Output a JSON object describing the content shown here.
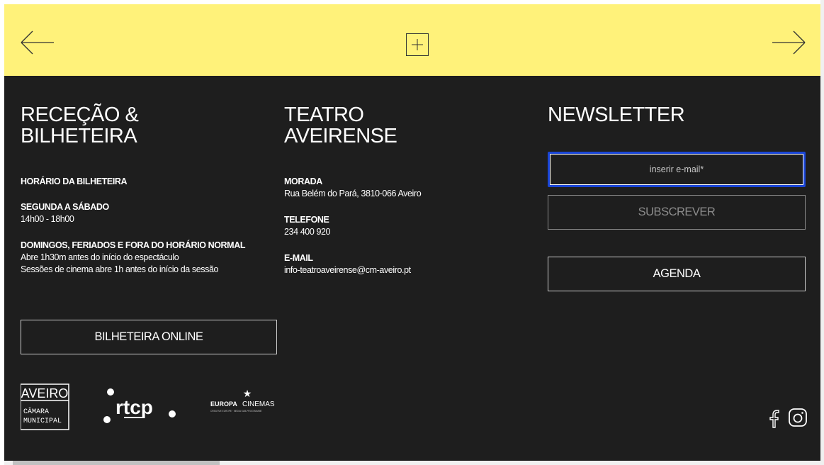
{
  "nav": {
    "prev_icon": "arrow-left-icon",
    "next_icon": "arrow-right-icon",
    "expand_icon": "plus-icon",
    "bar_color": "#fff27a"
  },
  "reception": {
    "title": "RECEÇÃO & BILHETEIRA",
    "hours_title": "HORÁRIO DA BILHETEIRA",
    "weekday_label": "SEGUNDA A SÁBADO",
    "weekday_hours": "14h00 - 18h00",
    "weekend_label": "DOMINGOS, FERIADOS E FORA DO HORÁRIO NORMAL",
    "weekend_line1": "Abre 1h30m antes do início do espectáculo",
    "weekend_line2": "Sessões de cinema abre 1h antes do início da sessão",
    "online_button": "BILHETEIRA ONLINE"
  },
  "theatre": {
    "title": "TEATRO AVEIRENSE",
    "address_label": "MORADA",
    "address_value": "Rua Belém do Pará, 3810-066 Aveiro",
    "phone_label": "TELEFONE",
    "phone_value": "234 400 920",
    "email_label": "E-MAIL",
    "email_value": "info-teatroaveirense@cm-aveiro.pt"
  },
  "newsletter": {
    "title": "NEWSLETTER",
    "email_placeholder": "inserir e-mail*",
    "subscribe_button": "SUBSCREVER",
    "agenda_button": "AGENDA"
  },
  "logos": {
    "aveiro_top": "AVEIRO",
    "aveiro_bottom1": "CÂMARA",
    "aveiro_bottom2": "MUNICIPAL",
    "rtcp": "rtcp",
    "europa_main": "EUROPA",
    "europa_cinemas": "CINEMAS",
    "europa_sub": "CREATIVE EUROPE · MEDIA SUB-PROGRAMME"
  },
  "social": {
    "facebook_icon": "facebook-icon",
    "instagram_icon": "instagram-icon"
  },
  "colors": {
    "footer_bg": "#1e1e1e",
    "focus_ring": "#1a45d6"
  }
}
